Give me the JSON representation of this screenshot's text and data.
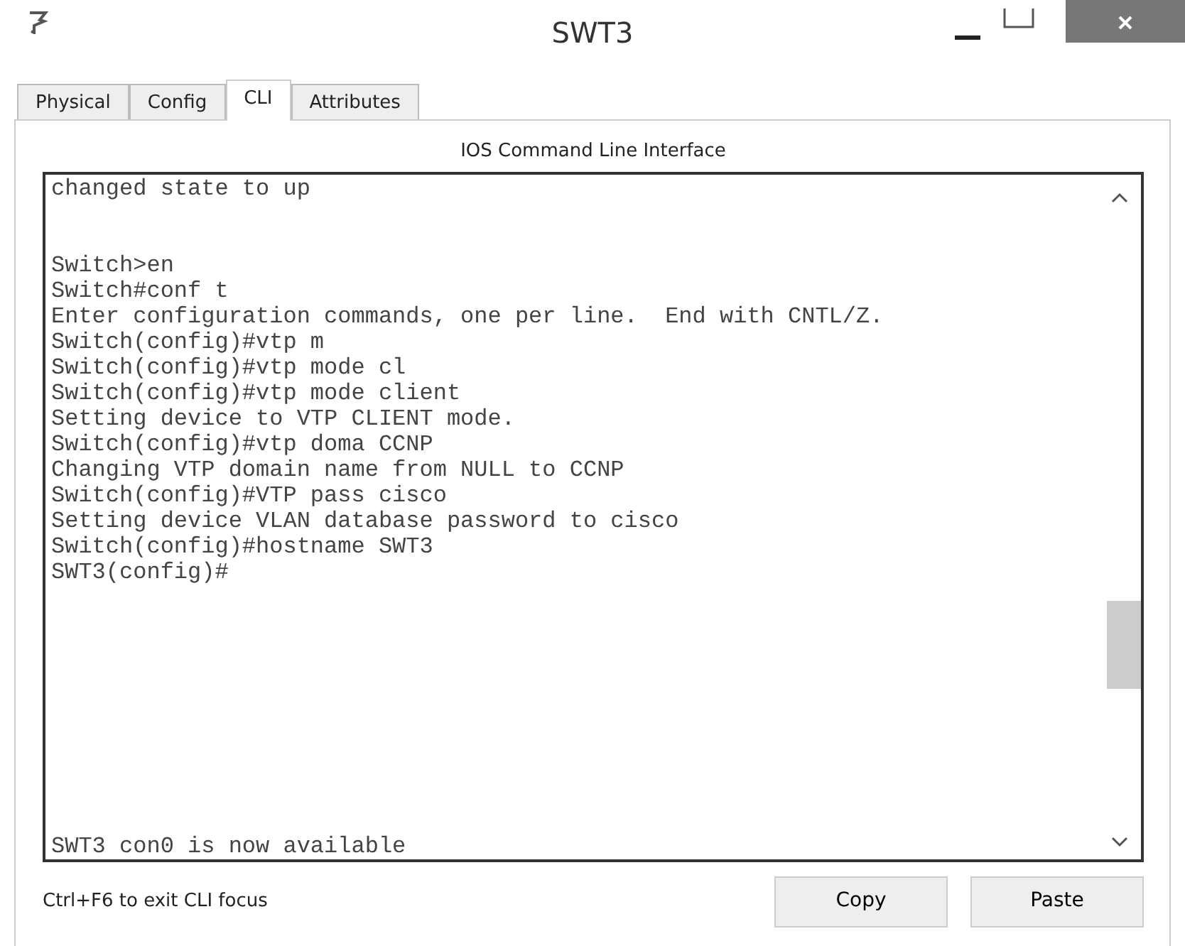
{
  "window": {
    "title": "SWT3"
  },
  "tabs": [
    {
      "label": "Physical",
      "selected": false
    },
    {
      "label": "Config",
      "selected": false
    },
    {
      "label": "CLI",
      "selected": true
    },
    {
      "label": "Attributes",
      "selected": false
    }
  ],
  "cli": {
    "heading": "IOS Command Line Interface",
    "lines": [
      {
        "kind": "text",
        "text": "changed state to up"
      },
      {
        "kind": "blank"
      },
      {
        "kind": "blank"
      },
      {
        "kind": "text",
        "text": "Switch>en"
      },
      {
        "kind": "text",
        "text": "Switch#conf t"
      },
      {
        "kind": "text",
        "text": "Enter configuration commands, one per line.  End with CNTL/Z."
      },
      {
        "kind": "text",
        "text": "Switch(config)#vtp m"
      },
      {
        "kind": "text",
        "text": "Switch(config)#vtp mode cl"
      },
      {
        "kind": "text",
        "text": "Switch(config)#vtp mode client"
      },
      {
        "kind": "text",
        "text": "Setting device to VTP CLIENT mode."
      },
      {
        "kind": "text",
        "text": "Switch(config)#vtp doma CCNP"
      },
      {
        "kind": "text",
        "text": "Changing VTP domain name from NULL to CCNP"
      },
      {
        "kind": "text",
        "text": "Switch(config)#VTP pass cisco"
      },
      {
        "kind": "text",
        "text": "Setting device VLAN database password to cisco"
      },
      {
        "kind": "text",
        "text": "Switch(config)#hostname SWT3"
      },
      {
        "kind": "text",
        "text": "SWT3(config)#"
      }
    ],
    "bottom_line": "SWT3 con0 is now available"
  },
  "footer": {
    "hint": "Ctrl+F6 to exit CLI focus",
    "buttons": [
      "Copy",
      "Paste"
    ]
  }
}
